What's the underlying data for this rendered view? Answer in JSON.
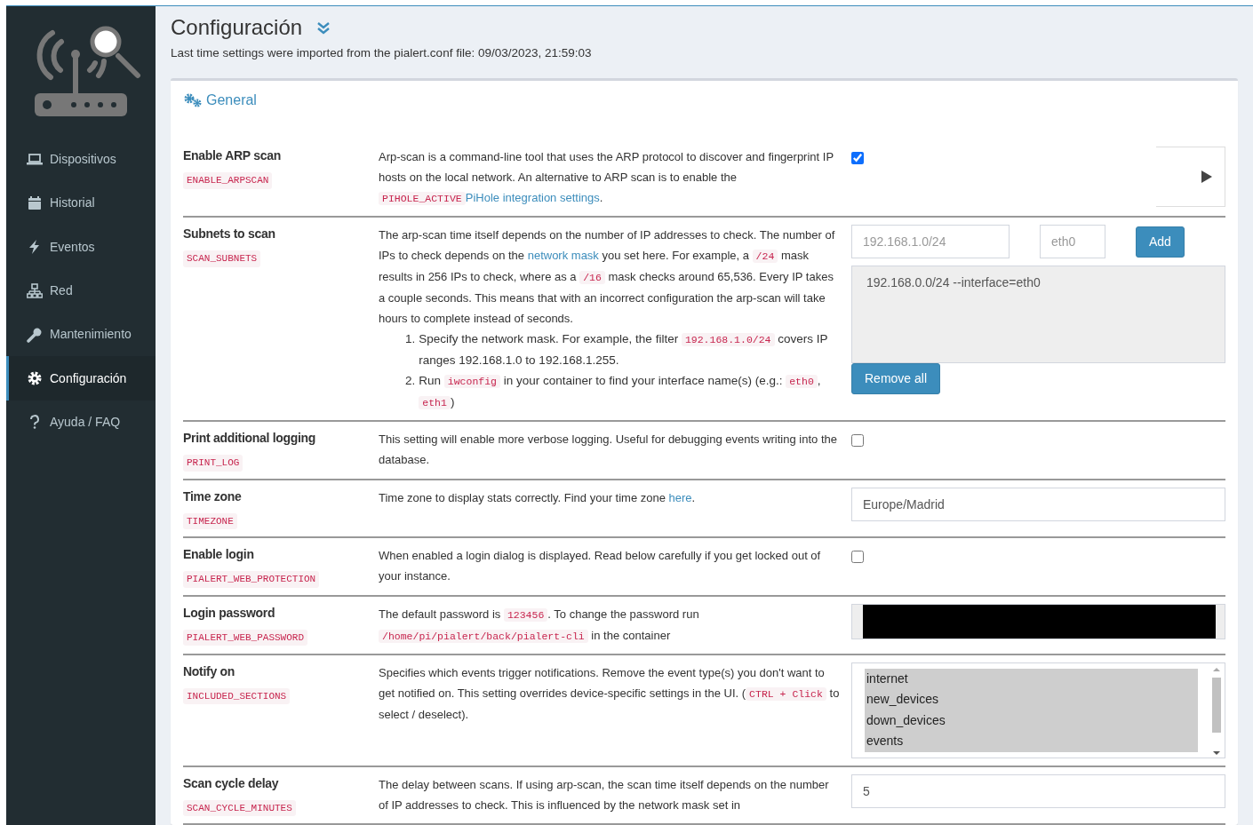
{
  "sidebar": {
    "items": [
      {
        "label": "Dispositivos",
        "selected": false
      },
      {
        "label": "Historial",
        "selected": false
      },
      {
        "label": "Eventos",
        "selected": false
      },
      {
        "label": "Red",
        "selected": false
      },
      {
        "label": "Mantenimiento",
        "selected": false
      },
      {
        "label": "Configuración",
        "selected": true
      },
      {
        "label": "Ayuda / FAQ",
        "selected": false
      }
    ]
  },
  "header": {
    "title": "Configuración",
    "subtitle": "Last time settings were imported from the pialert.conf file: 09/03/2023, 21:59:03"
  },
  "section": {
    "title": "General",
    "settings": [
      {
        "label": "Enable ARP scan",
        "code": "ENABLE_ARPSCAN",
        "kind": "checkbox",
        "checked": true,
        "expanded": false,
        "description": [
          {
            "kind": "text",
            "s": "Arp-scan is a command-line tool that uses the ARP protocol to discover and fingerprint IP hosts on the local network. An alternative to ARP scan is to enable the "
          },
          {
            "kind": "code",
            "s": "PIHOLE_ACTIVE"
          },
          {
            "kind": "link",
            "s": "PiHole integration settings"
          },
          {
            "kind": "text",
            "s": "."
          }
        ]
      },
      {
        "label": "Subnets to scan",
        "code": "SCAN_SUBNETS",
        "kind": "subnets",
        "ip_field": {
          "placeholder": "192.168.1.0/24"
        },
        "interface_field": {
          "placeholder": "eth0"
        },
        "add_button": "Add",
        "entries": [
          "192.168.0.0/24 --interface=eth0"
        ],
        "remove_button": "Remove all",
        "description": [
          {
            "kind": "text",
            "s": "The arp-scan time itself depends on the number of IP addresses to check. The number of IPs to check depends on the "
          },
          {
            "kind": "link",
            "s": "network mask"
          },
          {
            "kind": "text",
            "s": " you set here. For example, a "
          },
          {
            "kind": "code",
            "s": "/24"
          },
          {
            "kind": "text",
            "s": " mask results in 256 IPs to check, where as a "
          },
          {
            "kind": "code",
            "s": "/16"
          },
          {
            "kind": "text",
            "s": " mask checks around 65,536. Every IP takes a couple seconds. This means that with an incorrect configuration the arp-scan will take hours to complete instead of seconds."
          }
        ],
        "steps": [
          {
            "number": "1.",
            "parts": [
              {
                "kind": "text",
                "s": "Specify the network mask. For example, the filter "
              },
              {
                "kind": "code",
                "s": "192.168.1.0/24"
              },
              {
                "kind": "text",
                "s": " covers IP ranges 192.168.1.0 to 192.168.1.255."
              }
            ]
          },
          {
            "number": "2.",
            "parts": [
              {
                "kind": "text",
                "s": "Run "
              },
              {
                "kind": "code",
                "s": "iwconfig"
              },
              {
                "kind": "text",
                "s": " in your container to find your interface name(s) (e.g.: "
              },
              {
                "kind": "code",
                "s": "eth0"
              },
              {
                "kind": "text",
                "s": ", "
              },
              {
                "kind": "code",
                "s": "eth1"
              },
              {
                "kind": "text",
                "s": ")"
              }
            ]
          }
        ]
      },
      {
        "label": "Print additional logging",
        "code": "PRINT_LOG",
        "kind": "checkbox",
        "checked": false,
        "description": [
          {
            "kind": "text",
            "s": "This setting will enable more verbose logging. Useful for debugging events writing into the database."
          }
        ]
      },
      {
        "label": "Time zone",
        "code": "TIMEZONE",
        "kind": "text",
        "value": "Europe/Madrid",
        "description": [
          {
            "kind": "text",
            "s": "Time zone to display stats correctly. Find your time zone "
          },
          {
            "kind": "link",
            "s": "here"
          },
          {
            "kind": "text",
            "s": "."
          }
        ]
      },
      {
        "label": "Enable login",
        "code": "PIALERT_WEB_PROTECTION",
        "kind": "checkbox",
        "checked": false,
        "description": [
          {
            "kind": "text",
            "s": "When enabled a login dialog is displayed. Read below carefully if you get locked out of your instance."
          }
        ]
      },
      {
        "label": "Login password",
        "code": "PIALERT_WEB_PASSWORD",
        "kind": "password",
        "description": [
          {
            "kind": "text",
            "s": "The default password is "
          },
          {
            "kind": "code",
            "s": "123456"
          },
          {
            "kind": "text",
            "s": ". To change the password run "
          },
          {
            "kind": "code",
            "s": "/home/pi/pialert/back/pialert-cli"
          },
          {
            "kind": "text",
            "s": " in the container"
          }
        ]
      },
      {
        "label": "Notify on",
        "code": "INCLUDED_SECTIONS",
        "kind": "multiselect",
        "options": [
          {
            "label": "internet",
            "selected": true
          },
          {
            "label": "new_devices",
            "selected": true
          },
          {
            "label": "down_devices",
            "selected": true
          },
          {
            "label": "events",
            "selected": true
          }
        ],
        "description": [
          {
            "kind": "text",
            "s": "Specifies which events trigger notifications. Remove the event type(s) you don't want to get notified on. This setting overrides device-specific settings in the UI. ("
          },
          {
            "kind": "code",
            "s": "CTRL + Click"
          },
          {
            "kind": "text",
            "s": " to select / deselect)."
          }
        ]
      },
      {
        "label": "Scan cycle delay",
        "code": "SCAN_CYCLE_MINUTES",
        "kind": "text",
        "value": "5",
        "description": [
          {
            "kind": "text",
            "s": "The delay between scans. If using arp-scan, the scan time itself depends on the number of IP addresses to check. This is influenced by the network mask set in"
          }
        ]
      }
    ]
  }
}
